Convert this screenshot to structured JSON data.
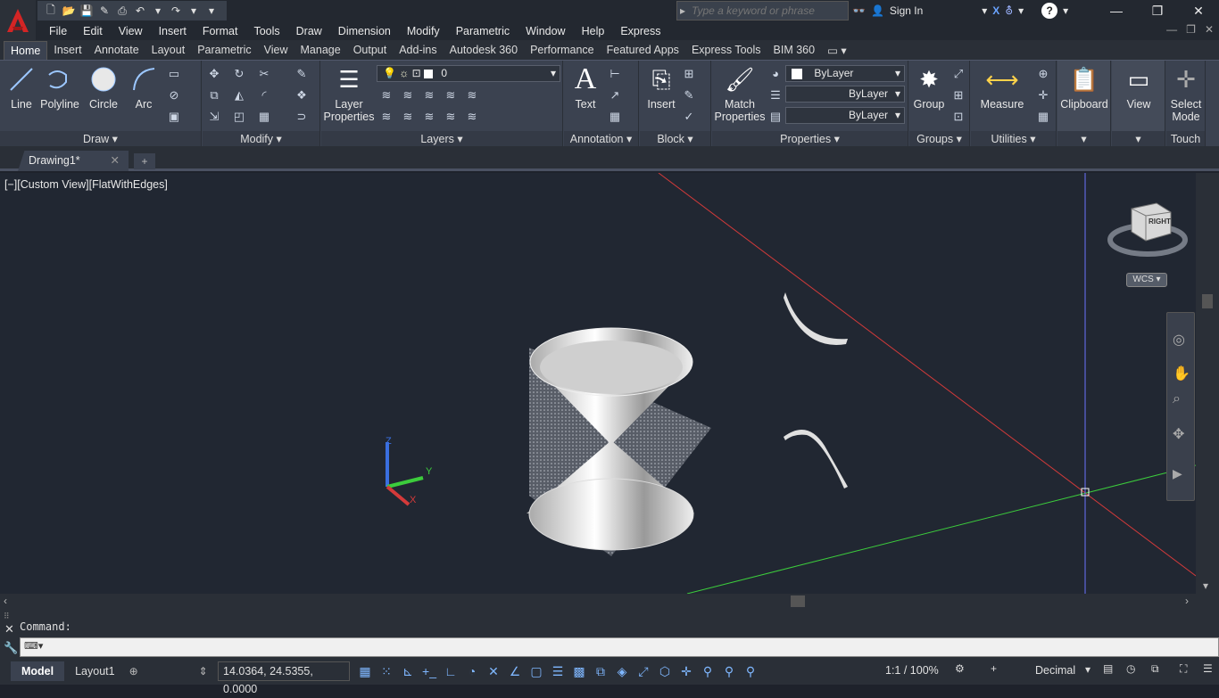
{
  "app": {
    "logo_letter": "A"
  },
  "search": {
    "placeholder": "Type a keyword or phrase"
  },
  "account": {
    "sign_in": "Sign In"
  },
  "menu": [
    "File",
    "Edit",
    "View",
    "Insert",
    "Format",
    "Tools",
    "Draw",
    "Dimension",
    "Modify",
    "Parametric",
    "Window",
    "Help",
    "Express"
  ],
  "ribbon_tabs": [
    "Home",
    "Insert",
    "Annotate",
    "Layout",
    "Parametric",
    "View",
    "Manage",
    "Output",
    "Add-ins",
    "Autodesk 360",
    "Performance",
    "Featured Apps",
    "Express Tools",
    "BIM 360"
  ],
  "draw": {
    "title": "Draw",
    "line": "Line",
    "polyline": "Polyline",
    "circle": "Circle",
    "arc": "Arc"
  },
  "modify": {
    "title": "Modify"
  },
  "layers": {
    "title": "Layers",
    "layer_properties_1": "Layer",
    "layer_properties_2": "Properties",
    "current_layer": "0"
  },
  "annotation": {
    "title": "Annotation",
    "text": "Text"
  },
  "block": {
    "title": "Block",
    "insert": "Insert"
  },
  "properties": {
    "title": "Properties",
    "match_1": "Match",
    "match_2": "Properties",
    "color": "ByLayer",
    "linetype": "ByLayer",
    "lineweight": "ByLayer"
  },
  "groups": {
    "title": "Groups",
    "group": "Group"
  },
  "utilities": {
    "title": "Utilities",
    "measure": "Measure"
  },
  "clipboard": {
    "label": "Clipboard"
  },
  "view_panel": {
    "label": "View"
  },
  "touch": {
    "title": "Touch",
    "select_mode_1": "Select",
    "select_mode_2": "Mode"
  },
  "document": {
    "tab": "Drawing1*",
    "view_label": "[−][Custom View][FlatWithEdges]"
  },
  "viewcube": {
    "face": "RIGHT",
    "wcs": "WCS"
  },
  "command": {
    "history": "Command:"
  },
  "status": {
    "model": "Model",
    "layout": "Layout1",
    "coords": "14.0364, 24.5355, 0.0000",
    "scale": "1:1 / 100%",
    "units": "Decimal"
  },
  "colors": {
    "accent": "#cc2a2a",
    "viewport": "#212732",
    "ucs_x": "#d43a3a",
    "ucs_y": "#3ccc3c",
    "ucs_z": "#3a6fe0"
  }
}
